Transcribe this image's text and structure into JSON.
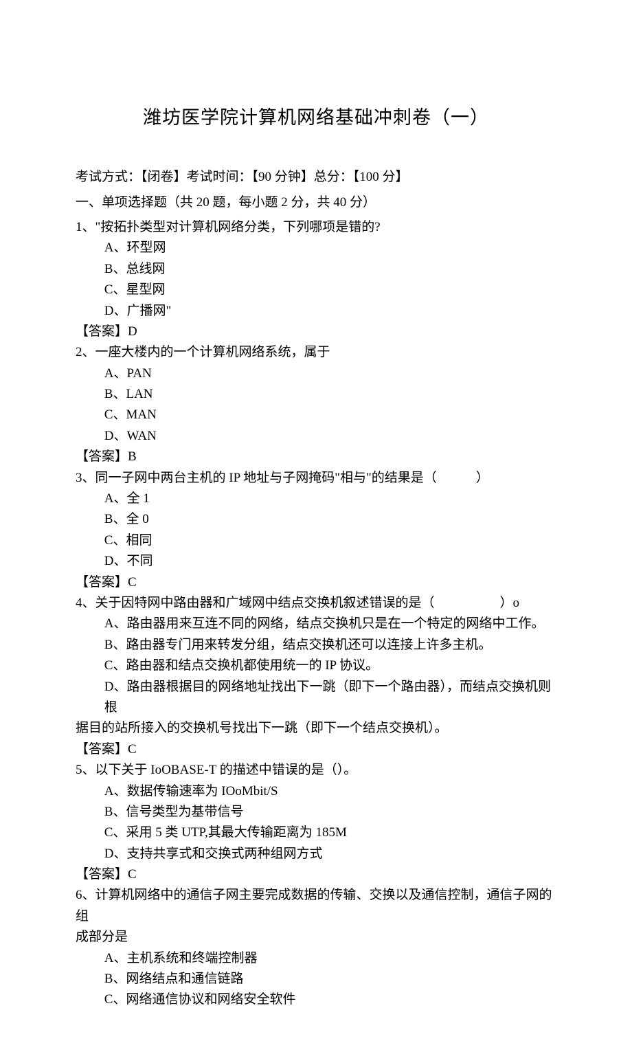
{
  "title": "潍坊医学院计算机网络基础冲刺卷（一）",
  "meta": "考试方式：【闭卷】考试时间：【90 分钟】总分：【100 分】",
  "section1": "一、单项选择题（共 20 题，每小题 2 分，共 40 分）",
  "q1": {
    "stem": "1、\"按拓扑类型对计算机网络分类，下列哪项是错的?",
    "a": "A、环型网",
    "b": "B、总线网",
    "c": "C、星型网",
    "d": "D、广播网\"",
    "ans": "【答案】D"
  },
  "q2": {
    "stem": "2、一座大楼内的一个计算机网络系统，属于",
    "a": "A、PAN",
    "b": "B、LAN",
    "c": "C、MAN",
    "d": "D、WAN",
    "ans": "【答案】B"
  },
  "q3": {
    "stem": "3、同一子网中两台主机的 IP 地址与子网掩码\"相与\"的结果是（　　　）",
    "a": "A、全 1",
    "b": "B、全 0",
    "c": "C、相同",
    "d": "D、不同",
    "ans": "【答案】C"
  },
  "q4": {
    "stem": "4、关于因特网中路由器和广域网中结点交换机叙述错误的是（　　　　　）o",
    "a": "A、路由器用来互连不同的网络，结点交换机只是在一个特定的网络中工作。",
    "b": "B、路由器专门用来转发分组，结点交换机还可以连接上许多主机。",
    "c": "C、路由器和结点交换机都使用统一的 IP 协议。",
    "d": "D、路由器根据目的网络地址找出下一跳（即下一个路由器），而结点交换机则根",
    "dcont": "据目的站所接入的交换机号找出下一跳（即下一个结点交换机）。",
    "ans": "【答案】C"
  },
  "q5": {
    "stem": "5、以下关于 IoOBASE-T 的描述中错误的是（）。",
    "a": "A、数据传输速率为 IOoMbit/S",
    "b": "B、信号类型为基带信号",
    "c": "C、采用 5 类 UTP,其最大传输距离为 185M",
    "d": "D、支持共享式和交换式两种组网方式",
    "ans": "【答案】C"
  },
  "q6": {
    "stem": "6、计算机网络中的通信子网主要完成数据的传输、交换以及通信控制，通信子网的组",
    "stemcont": "成部分是",
    "a": "A、主机系统和终端控制器",
    "b": "B、网络结点和通信链路",
    "c": "C、网络通信协议和网络安全软件"
  }
}
